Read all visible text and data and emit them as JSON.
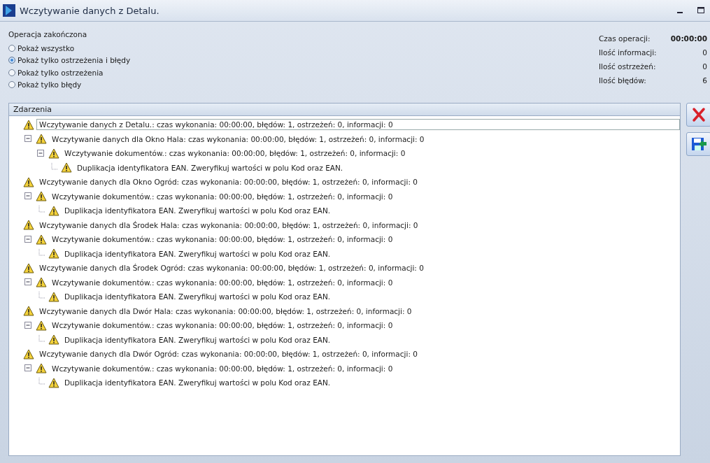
{
  "window": {
    "title": "Wczytywanie danych z Detalu."
  },
  "status": {
    "title": "Operacja zakończona"
  },
  "filters": [
    {
      "label": "Pokaż wszystko",
      "selected": false
    },
    {
      "label": "Pokaż tylko ostrzeżenia i błędy",
      "selected": true
    },
    {
      "label": "Pokaż tylko ostrzeżenia",
      "selected": false
    },
    {
      "label": "Pokaż tylko błędy",
      "selected": false
    }
  ],
  "stats": [
    {
      "label": "Czas operacji:",
      "value": "00:00:00",
      "kind": "time"
    },
    {
      "label": "Ilość informacji:",
      "value": "0",
      "kind": "count"
    },
    {
      "label": "Ilość ostrzeżeń:",
      "value": "0",
      "kind": "count"
    },
    {
      "label": "Ilość błędów:",
      "value": "6",
      "kind": "count"
    }
  ],
  "events": {
    "title": "Zdarzenia",
    "items": [
      {
        "text": "Wczytywanie danych z Detalu.: czas wykonania: 00:00:00, błędów: 1, ostrzeżeń: 0, informacji: 0",
        "selected": true,
        "children": [
          {
            "text": "Wczytywanie danych dla Okno Hala: czas wykonania: 00:00:00, błędów: 1, ostrzeżeń: 0, informacji: 0",
            "selected": false,
            "expanded": true,
            "children": [
              {
                "text": "Wczytywanie dokumentów.: czas wykonania: 00:00:00, błędów: 1, ostrzeżeń: 0, informacji: 0",
                "selected": false,
                "expanded": true,
                "children": [
                  {
                    "text": "Duplikacja identyfikatora EAN. Zweryfikuj wartości w polu Kod oraz EAN.",
                    "selected": false
                  }
                ]
              }
            ]
          }
        ]
      },
      {
        "text": "Wczytywanie danych dla Okno Ogród: czas wykonania: 00:00:00, błędów: 1, ostrzeżeń: 0, informacji: 0",
        "selected": false,
        "children": [
          {
            "text": "Wczytywanie dokumentów.: czas wykonania: 00:00:00, błędów: 1, ostrzeżeń: 0, informacji: 0",
            "selected": false,
            "expanded": true,
            "children": [
              {
                "text": "Duplikacja identyfikatora EAN. Zweryfikuj wartości w polu Kod oraz EAN.",
                "selected": false
              }
            ]
          }
        ]
      },
      {
        "text": "Wczytywanie danych dla Środek Hala: czas wykonania: 00:00:00, błędów: 1, ostrzeżeń: 0, informacji: 0",
        "selected": false,
        "children": [
          {
            "text": "Wczytywanie dokumentów.: czas wykonania: 00:00:00, błędów: 1, ostrzeżeń: 0, informacji: 0",
            "selected": false,
            "expanded": true,
            "children": [
              {
                "text": "Duplikacja identyfikatora EAN. Zweryfikuj wartości w polu Kod oraz EAN.",
                "selected": false
              }
            ]
          }
        ]
      },
      {
        "text": "Wczytywanie danych dla Środek Ogród: czas wykonania: 00:00:00, błędów: 1, ostrzeżeń: 0, informacji: 0",
        "selected": false,
        "children": [
          {
            "text": "Wczytywanie dokumentów.: czas wykonania: 00:00:00, błędów: 1, ostrzeżeń: 0, informacji: 0",
            "selected": false,
            "expanded": true,
            "children": [
              {
                "text": "Duplikacja identyfikatora EAN. Zweryfikuj wartości w polu Kod oraz EAN.",
                "selected": false
              }
            ]
          }
        ]
      },
      {
        "text": "Wczytywanie danych dla Dwór Hala: czas wykonania: 00:00:00, błędów: 1, ostrzeżeń: 0, informacji: 0",
        "selected": false,
        "children": [
          {
            "text": "Wczytywanie dokumentów.: czas wykonania: 00:00:00, błędów: 1, ostrzeżeń: 0, informacji: 0",
            "selected": false,
            "expanded": true,
            "children": [
              {
                "text": "Duplikacja identyfikatora EAN. Zweryfikuj wartości w polu Kod oraz EAN.",
                "selected": false
              }
            ]
          }
        ]
      },
      {
        "text": "Wczytywanie danych dla Dwór Ogród: czas wykonania: 00:00:00, błędów: 1, ostrzeżeń: 0, informacji: 0",
        "selected": false,
        "children": [
          {
            "text": "Wczytywanie dokumentów.: czas wykonania: 00:00:00, błędów: 1, ostrzeżeń: 0, informacji: 0",
            "selected": false,
            "expanded": true,
            "children": [
              {
                "text": "Duplikacja identyfikatora EAN. Zweryfikuj wartości w polu Kod oraz EAN.",
                "selected": false
              }
            ]
          }
        ]
      }
    ]
  }
}
